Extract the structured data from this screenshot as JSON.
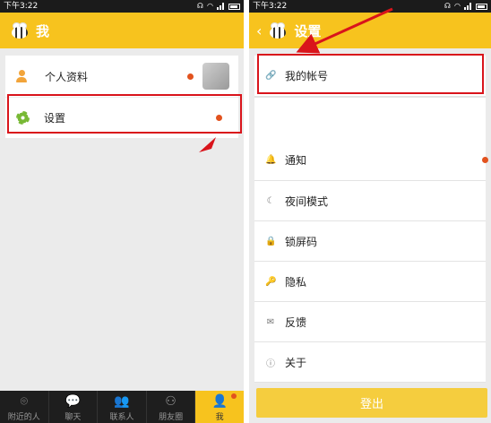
{
  "left": {
    "status": {
      "time": "下午3:22"
    },
    "appbar": {
      "title": "我"
    },
    "menu": [
      {
        "label": "个人资料",
        "icon": "person-icon"
      },
      {
        "label": "设置",
        "icon": "gear-icon"
      }
    ],
    "tabs": [
      {
        "label": "附近的人",
        "icon": "location-pin-icon",
        "glyph": "⌾"
      },
      {
        "label": "聊天",
        "icon": "chat-bubble-icon",
        "glyph": "💬"
      },
      {
        "label": "联系人",
        "icon": "contacts-icon",
        "glyph": "👥"
      },
      {
        "label": "朋友圈",
        "icon": "circles-icon",
        "glyph": "⚇"
      },
      {
        "label": "我",
        "icon": "me-icon",
        "glyph": "👤"
      }
    ]
  },
  "right": {
    "status": {
      "time": "下午3:22"
    },
    "appbar": {
      "title": "设置"
    },
    "account": {
      "label": "我的帐号",
      "icon": "link-icon"
    },
    "settings": [
      {
        "label": "通知",
        "icon": "bell-icon",
        "glyph": "🔔"
      },
      {
        "label": "夜间模式",
        "icon": "moon-icon",
        "glyph": "☾"
      },
      {
        "label": "锁屏码",
        "icon": "lock-icon",
        "glyph": "🔒"
      },
      {
        "label": "隐私",
        "icon": "key-icon",
        "glyph": "🔑"
      },
      {
        "label": "反馈",
        "icon": "mail-icon",
        "glyph": "✉"
      },
      {
        "label": "关于",
        "icon": "info-icon",
        "glyph": "ⓘ"
      }
    ],
    "logout_label": "登出"
  },
  "colors": {
    "accent": "#f7c31e",
    "highlight": "#d9141b",
    "badge": "#e2521e"
  }
}
